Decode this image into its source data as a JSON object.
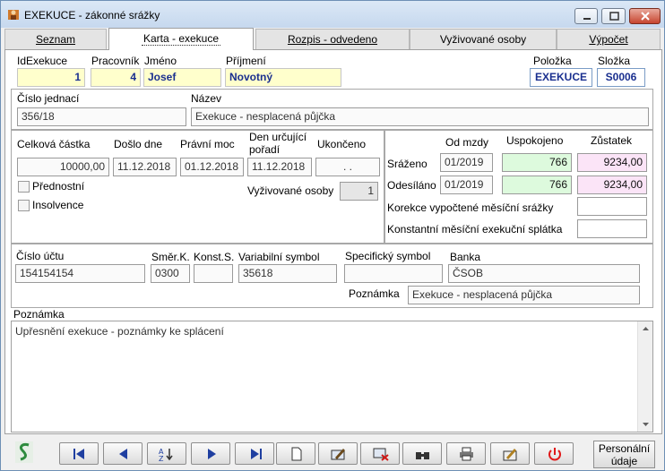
{
  "window": {
    "title": "EXEKUCE - zákonné srážky"
  },
  "tabs": [
    {
      "label": "Seznam"
    },
    {
      "label": "Karta - exekuce"
    },
    {
      "label": "Rozpis - odvedeno"
    },
    {
      "label": "Vyživované osoby"
    },
    {
      "label": "Výpočet"
    }
  ],
  "header": {
    "id_label": "IdExekuce",
    "id_value": "1",
    "prac_label": "Pracovník",
    "prac_value": "4",
    "jmeno_label": "Jméno",
    "jmeno_value": "Josef",
    "prijmeni_label": "Příjmení",
    "prijmeni_value": "Novotný",
    "polozka_label": "Položka",
    "polozka_value": "EXEKUCE",
    "slozka_label": "Složka",
    "slozka_value": "S0006"
  },
  "case": {
    "cislo_label": "Číslo jednací",
    "cislo_value": "356/18",
    "nazev_label": "Název",
    "nazev_value": "Exekuce - nesplacená půjčka"
  },
  "amounts": {
    "celkova_label": "Celková částka",
    "celkova_value": "10000,00",
    "doslo_label": "Došlo dne",
    "doslo_value": "11.12.2018",
    "pravni_label": "Právní moc",
    "pravni_value": "01.12.2018",
    "den_label_1": "Den určující",
    "den_label_2": "pořadí",
    "den_value": "11.12.2018",
    "ukonceno_label": "Ukončeno",
    "ukonceno_value": ". .",
    "prednostni_label": "Přednostní",
    "insolvence_label": "Insolvence",
    "vyzivovane_label": "Vyživované osoby",
    "vyzivovane_value": "1"
  },
  "summary": {
    "od_mzdy_label": "Od mzdy",
    "uspokojeno_label": "Uspokojeno",
    "zustatek_label": "Zůstatek",
    "srazeno_label": "Sráženo",
    "srazeno_od": "01/2019",
    "srazeno_usp": "766",
    "srazeno_zust": "9234,00",
    "odesilano_label": "Odesíláno",
    "odesilano_od": "01/2019",
    "odesilano_usp": "766",
    "odesilano_zust": "9234,00",
    "korekce_label": "Korekce vypočtené měsíční srážky",
    "konstantni_label": "Konstantní měsíční exekuční splátka"
  },
  "bank": {
    "ucet_label": "Číslo účtu",
    "ucet_value": "154154154",
    "smerk_label": "Směr.K.",
    "smerk_value": "0300",
    "konsts_label": "Konst.S.",
    "konsts_value": "",
    "variabilni_label": "Variabilní symbol",
    "variabilni_value": "35618",
    "specificky_label": "Specifický symbol",
    "specificky_value": "",
    "banka_label": "Banka",
    "banka_value": "ČSOB",
    "poznamka_label": "Poznámka",
    "poznamka_value": "Exekuce - nesplacená půjčka"
  },
  "note": {
    "label": "Poznámka",
    "value": "Upřesnění exekuce - poznámky ke splácení"
  },
  "toolbar": {
    "icons": [
      "first-icon",
      "prev-icon",
      "sort-icon",
      "next-icon",
      "last-icon",
      "new-icon",
      "edit-icon",
      "delete-icon",
      "find-icon",
      "print-icon",
      "tools-icon",
      "power-icon"
    ],
    "personal_line1": "Personální",
    "personal_line2": "údaje"
  },
  "colors": {
    "accent_blue": "#1a2f8f",
    "yellow_field": "#ffffcc",
    "green_field": "#ddfadd",
    "pink_field": "#fbe4f7"
  }
}
